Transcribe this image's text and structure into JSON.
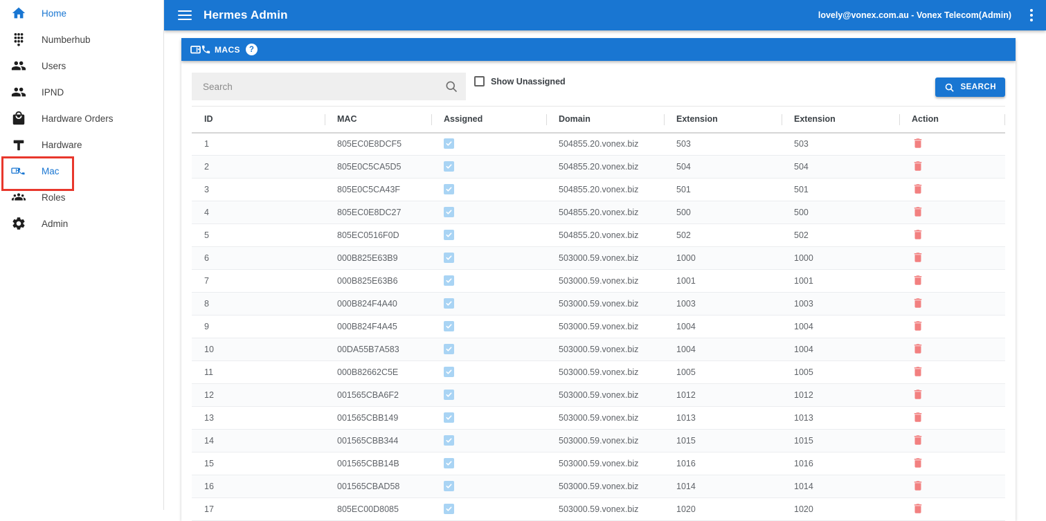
{
  "appbar": {
    "title": "Hermes Admin",
    "user": "lovely@vonex.com.au - Vonex Telecom(Admin)"
  },
  "sidebar": {
    "items": [
      {
        "label": "Home",
        "icon": "home-icon",
        "active": true,
        "highlighted": false
      },
      {
        "label": "Numberhub",
        "icon": "dialpad-icon",
        "active": false,
        "highlighted": false
      },
      {
        "label": "Users",
        "icon": "people-icon",
        "active": false,
        "highlighted": false
      },
      {
        "label": "IPND",
        "icon": "people-icon",
        "active": false,
        "highlighted": false
      },
      {
        "label": "Hardware Orders",
        "icon": "bag-icon",
        "active": false,
        "highlighted": false
      },
      {
        "label": "Hardware",
        "icon": "hammer-icon",
        "active": false,
        "highlighted": false
      },
      {
        "label": "Mac",
        "icon": "mac-phone-icon",
        "active": true,
        "highlighted": true
      },
      {
        "label": "Roles",
        "icon": "group-icon",
        "active": false,
        "highlighted": false
      },
      {
        "label": "Admin",
        "icon": "gear-icon",
        "active": false,
        "highlighted": false
      }
    ]
  },
  "tabs": {
    "macs_label": "MACS",
    "macs_icon": "mac-phone-icon",
    "help_glyph": "?"
  },
  "filters": {
    "search_placeholder": "Search",
    "show_unassigned_label": "Show Unassigned",
    "show_unassigned_checked": false,
    "search_button_label": "SEARCH"
  },
  "table": {
    "columns": [
      "ID",
      "MAC",
      "Assigned",
      "Domain",
      "Extension",
      "Extension",
      "Action"
    ],
    "rows": [
      {
        "id": "1",
        "mac": "805EC0E8DCF5",
        "assigned": true,
        "domain": "504855.20.vonex.biz",
        "ext1": "503",
        "ext2": "503"
      },
      {
        "id": "2",
        "mac": "805E0C5CA5D5",
        "assigned": true,
        "domain": "504855.20.vonex.biz",
        "ext1": "504",
        "ext2": "504"
      },
      {
        "id": "3",
        "mac": "805E0C5CA43F",
        "assigned": true,
        "domain": "504855.20.vonex.biz",
        "ext1": "501",
        "ext2": "501"
      },
      {
        "id": "4",
        "mac": "805EC0E8DC27",
        "assigned": true,
        "domain": "504855.20.vonex.biz",
        "ext1": "500",
        "ext2": "500"
      },
      {
        "id": "5",
        "mac": "805EC0516F0D",
        "assigned": true,
        "domain": "504855.20.vonex.biz",
        "ext1": "502",
        "ext2": "502"
      },
      {
        "id": "6",
        "mac": "000B825E63B9",
        "assigned": true,
        "domain": "503000.59.vonex.biz",
        "ext1": "1000",
        "ext2": "1000"
      },
      {
        "id": "7",
        "mac": "000B825E63B6",
        "assigned": true,
        "domain": "503000.59.vonex.biz",
        "ext1": "1001",
        "ext2": "1001"
      },
      {
        "id": "8",
        "mac": "000B824F4A40",
        "assigned": true,
        "domain": "503000.59.vonex.biz",
        "ext1": "1003",
        "ext2": "1003"
      },
      {
        "id": "9",
        "mac": "000B824F4A45",
        "assigned": true,
        "domain": "503000.59.vonex.biz",
        "ext1": "1004",
        "ext2": "1004"
      },
      {
        "id": "10",
        "mac": "00DA55B7A583",
        "assigned": true,
        "domain": "503000.59.vonex.biz",
        "ext1": "1004",
        "ext2": "1004"
      },
      {
        "id": "11",
        "mac": "000B82662C5E",
        "assigned": true,
        "domain": "503000.59.vonex.biz",
        "ext1": "1005",
        "ext2": "1005"
      },
      {
        "id": "12",
        "mac": "001565CBA6F2",
        "assigned": true,
        "domain": "503000.59.vonex.biz",
        "ext1": "1012",
        "ext2": "1012"
      },
      {
        "id": "13",
        "mac": "001565CBB149",
        "assigned": true,
        "domain": "503000.59.vonex.biz",
        "ext1": "1013",
        "ext2": "1013"
      },
      {
        "id": "14",
        "mac": "001565CBB344",
        "assigned": true,
        "domain": "503000.59.vonex.biz",
        "ext1": "1015",
        "ext2": "1015"
      },
      {
        "id": "15",
        "mac": "001565CBB14B",
        "assigned": true,
        "domain": "503000.59.vonex.biz",
        "ext1": "1016",
        "ext2": "1016"
      },
      {
        "id": "16",
        "mac": "001565CBAD58",
        "assigned": true,
        "domain": "503000.59.vonex.biz",
        "ext1": "1014",
        "ext2": "1014"
      },
      {
        "id": "17",
        "mac": "805EC00D8085",
        "assigned": true,
        "domain": "503000.59.vonex.biz",
        "ext1": "1020",
        "ext2": "1020"
      }
    ]
  },
  "colors": {
    "primary_blue": "#1976d2",
    "annotation_red": "#e8372c",
    "trash_red": "#f28080",
    "checkbox_blue": "#a9d4f4"
  }
}
